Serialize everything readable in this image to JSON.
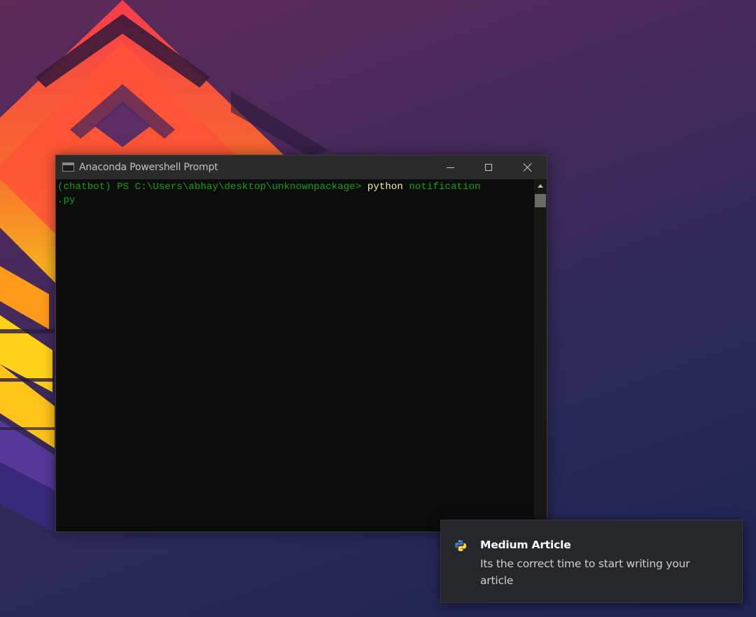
{
  "window": {
    "title": "Anaconda Powershell Prompt",
    "app_icon": "console-window-icon",
    "controls": {
      "minimize_icon": "minimize-icon",
      "maximize_icon": "maximize-icon",
      "close_icon": "close-icon"
    }
  },
  "console": {
    "prompt": "(chatbot) PS C:\\Users\\abhay\\desktop\\unknownpackage> ",
    "command": "python",
    "argument_part1": " notification",
    "argument_part2": ".py",
    "colors": {
      "prompt": "#13a10e",
      "command": "#f9f1a5",
      "background": "#0c0c0c"
    }
  },
  "notification": {
    "icon": "python-icon",
    "title": "Medium Article",
    "body": "Its the correct time to start writing your article"
  }
}
